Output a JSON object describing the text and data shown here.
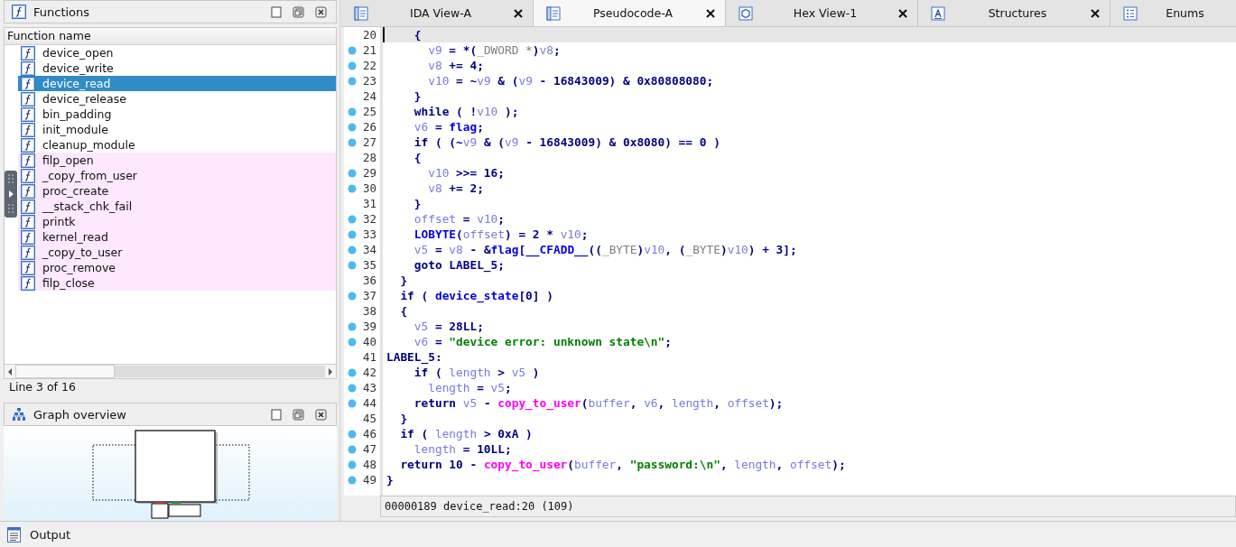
{
  "functions_panel": {
    "title": "Functions",
    "column_header": "Function name",
    "status": "Line 3 of 16",
    "items": [
      {
        "name": "device_open",
        "selected": false,
        "imported": false
      },
      {
        "name": "device_write",
        "selected": false,
        "imported": false
      },
      {
        "name": "device_read",
        "selected": true,
        "imported": false
      },
      {
        "name": "device_release",
        "selected": false,
        "imported": false
      },
      {
        "name": "bin_padding",
        "selected": false,
        "imported": false
      },
      {
        "name": "init_module",
        "selected": false,
        "imported": false
      },
      {
        "name": "cleanup_module",
        "selected": false,
        "imported": false
      },
      {
        "name": "filp_open",
        "selected": false,
        "imported": true
      },
      {
        "name": "_copy_from_user",
        "selected": false,
        "imported": true
      },
      {
        "name": "proc_create",
        "selected": false,
        "imported": true
      },
      {
        "name": "__stack_chk_fail",
        "selected": false,
        "imported": true
      },
      {
        "name": "printk",
        "selected": false,
        "imported": true
      },
      {
        "name": "kernel_read",
        "selected": false,
        "imported": true
      },
      {
        "name": "_copy_to_user",
        "selected": false,
        "imported": true
      },
      {
        "name": "proc_remove",
        "selected": false,
        "imported": true
      },
      {
        "name": "filp_close",
        "selected": false,
        "imported": true
      }
    ]
  },
  "graph_panel": {
    "title": "Graph overview"
  },
  "tabs": [
    {
      "label": "IDA View-A",
      "kind": "disasm",
      "selected": false,
      "closable": true
    },
    {
      "label": "Pseudocode-A",
      "kind": "pseudo",
      "selected": true,
      "closable": true
    },
    {
      "label": "Hex View-1",
      "kind": "hex",
      "selected": false,
      "closable": true
    },
    {
      "label": "Structures",
      "kind": "struct",
      "selected": false,
      "closable": true
    },
    {
      "label": "Enums",
      "kind": "enum",
      "selected": false,
      "closable": false
    }
  ],
  "code": {
    "lines": [
      {
        "number": "20",
        "marked": false,
        "current": true,
        "segments": [
          {
            "plain": "    {"
          }
        ]
      },
      {
        "number": "21",
        "marked": true,
        "current": false,
        "segments": [
          {
            "var": "      v9"
          },
          {
            "plain": " = *("
          },
          {
            "type": "_DWORD *"
          },
          {
            "plain": ")"
          },
          {
            "var": "v8"
          },
          {
            "plain": ";"
          }
        ]
      },
      {
        "number": "22",
        "marked": true,
        "current": false,
        "segments": [
          {
            "var": "      v8"
          },
          {
            "plain": " += 4;"
          }
        ]
      },
      {
        "number": "23",
        "marked": true,
        "current": false,
        "segments": [
          {
            "var": "      v10"
          },
          {
            "plain": " = ~"
          },
          {
            "var": "v9"
          },
          {
            "plain": " & ("
          },
          {
            "var": "v9"
          },
          {
            "plain": " - 16843009) & 0x80808080;"
          }
        ]
      },
      {
        "number": "24",
        "marked": false,
        "current": false,
        "segments": [
          {
            "plain": "    }"
          }
        ]
      },
      {
        "number": "25",
        "marked": true,
        "current": false,
        "segments": [
          {
            "plain": "    while ( !"
          },
          {
            "var": "v10"
          },
          {
            "plain": " );"
          }
        ]
      },
      {
        "number": "26",
        "marked": true,
        "current": false,
        "segments": [
          {
            "var": "    v6"
          },
          {
            "plain": " = "
          },
          {
            "global": "flag"
          },
          {
            "plain": ";"
          }
        ]
      },
      {
        "number": "27",
        "marked": true,
        "current": false,
        "segments": [
          {
            "plain": "    if ( (~"
          },
          {
            "var": "v9"
          },
          {
            "plain": " & ("
          },
          {
            "var": "v9"
          },
          {
            "plain": " - 16843009) & 0x8080) == 0 )"
          }
        ]
      },
      {
        "number": "28",
        "marked": false,
        "current": false,
        "segments": [
          {
            "plain": "    {"
          }
        ]
      },
      {
        "number": "29",
        "marked": true,
        "current": false,
        "segments": [
          {
            "var": "      v10"
          },
          {
            "plain": " >>= 16;"
          }
        ]
      },
      {
        "number": "30",
        "marked": true,
        "current": false,
        "segments": [
          {
            "var": "      v8"
          },
          {
            "plain": " += 2;"
          }
        ]
      },
      {
        "number": "31",
        "marked": false,
        "current": false,
        "segments": [
          {
            "plain": "    }"
          }
        ]
      },
      {
        "number": "32",
        "marked": true,
        "current": false,
        "segments": [
          {
            "var": "    offset"
          },
          {
            "plain": " = "
          },
          {
            "var": "v10"
          },
          {
            "plain": ";"
          }
        ]
      },
      {
        "number": "33",
        "marked": true,
        "current": false,
        "segments": [
          {
            "global": "    LOBYTE"
          },
          {
            "plain": "("
          },
          {
            "var": "offset"
          },
          {
            "plain": ") = 2 * "
          },
          {
            "var": "v10"
          },
          {
            "plain": ";"
          }
        ]
      },
      {
        "number": "34",
        "marked": true,
        "current": false,
        "segments": [
          {
            "var": "    v5"
          },
          {
            "plain": " = "
          },
          {
            "var": "v8"
          },
          {
            "plain": " - &"
          },
          {
            "global": "flag"
          },
          {
            "plain": "["
          },
          {
            "global": "__CFADD__"
          },
          {
            "plain": "(("
          },
          {
            "type": "_BYTE"
          },
          {
            "plain": ")"
          },
          {
            "var": "v10"
          },
          {
            "plain": ", ("
          },
          {
            "type": "_BYTE"
          },
          {
            "plain": ")"
          },
          {
            "var": "v10"
          },
          {
            "plain": ") + 3];"
          }
        ]
      },
      {
        "number": "35",
        "marked": true,
        "current": false,
        "segments": [
          {
            "plain": "    goto LABEL_5;"
          }
        ]
      },
      {
        "number": "36",
        "marked": false,
        "current": false,
        "segments": [
          {
            "plain": "  }"
          }
        ]
      },
      {
        "number": "37",
        "marked": true,
        "current": false,
        "segments": [
          {
            "plain": "  if ( "
          },
          {
            "global": "device_state"
          },
          {
            "plain": "[0] )"
          }
        ]
      },
      {
        "number": "38",
        "marked": false,
        "current": false,
        "segments": [
          {
            "plain": "  {"
          }
        ]
      },
      {
        "number": "39",
        "marked": true,
        "current": false,
        "segments": [
          {
            "var": "    v5"
          },
          {
            "plain": " = 28LL;"
          }
        ]
      },
      {
        "number": "40",
        "marked": true,
        "current": false,
        "segments": [
          {
            "var": "    v6"
          },
          {
            "plain": " = "
          },
          {
            "string": "\"device error: unknown state\\n\""
          },
          {
            "plain": ";"
          }
        ]
      },
      {
        "number": "41",
        "marked": false,
        "current": false,
        "segments": [
          {
            "plain": "LABEL_5:"
          }
        ]
      },
      {
        "number": "42",
        "marked": true,
        "current": false,
        "segments": [
          {
            "plain": "    if ( "
          },
          {
            "var": "length"
          },
          {
            "plain": " > "
          },
          {
            "var": "v5"
          },
          {
            "plain": " )"
          }
        ]
      },
      {
        "number": "43",
        "marked": true,
        "current": false,
        "segments": [
          {
            "var": "      length"
          },
          {
            "plain": " = "
          },
          {
            "var": "v5"
          },
          {
            "plain": ";"
          }
        ]
      },
      {
        "number": "44",
        "marked": true,
        "current": false,
        "segments": [
          {
            "plain": "    return "
          },
          {
            "var": "v5"
          },
          {
            "plain": " - "
          },
          {
            "call": "copy_to_user"
          },
          {
            "plain": "("
          },
          {
            "var": "buffer"
          },
          {
            "plain": ", "
          },
          {
            "var": "v6"
          },
          {
            "plain": ", "
          },
          {
            "var": "length"
          },
          {
            "plain": ", "
          },
          {
            "var": "offset"
          },
          {
            "plain": ");"
          }
        ]
      },
      {
        "number": "45",
        "marked": false,
        "current": false,
        "segments": [
          {
            "plain": "  }"
          }
        ]
      },
      {
        "number": "46",
        "marked": true,
        "current": false,
        "segments": [
          {
            "plain": "  if ( "
          },
          {
            "var": "length"
          },
          {
            "plain": " > 0xA )"
          }
        ]
      },
      {
        "number": "47",
        "marked": true,
        "current": false,
        "segments": [
          {
            "var": "    length"
          },
          {
            "plain": " = 10LL;"
          }
        ]
      },
      {
        "number": "48",
        "marked": true,
        "current": false,
        "segments": [
          {
            "plain": "  return 10 - "
          },
          {
            "call": "copy_to_user"
          },
          {
            "plain": "("
          },
          {
            "var": "buffer"
          },
          {
            "plain": ", "
          },
          {
            "string": "\"password:\\n\""
          },
          {
            "plain": ", "
          },
          {
            "var": "length"
          },
          {
            "plain": ", "
          },
          {
            "var": "offset"
          },
          {
            "plain": ");"
          }
        ]
      },
      {
        "number": "49",
        "marked": true,
        "current": false,
        "segments": [
          {
            "plain": "}"
          }
        ]
      }
    ]
  },
  "status_bar": "00000189 device_read:20 (109)",
  "output_panel": {
    "title": "Output"
  }
}
